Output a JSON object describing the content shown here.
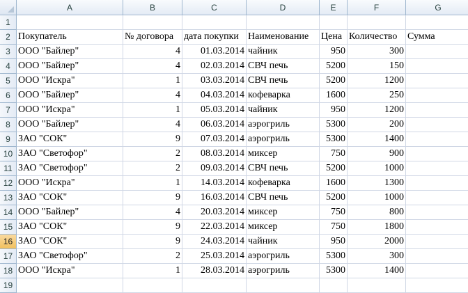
{
  "grid": {
    "columns": [
      "A",
      "B",
      "C",
      "D",
      "E",
      "F",
      "G"
    ],
    "active_row": "16",
    "rows": [
      {
        "n": "1",
        "cells": [
          "",
          "",
          "",
          "",
          "",
          "",
          ""
        ]
      },
      {
        "n": "2",
        "cells": [
          "Покупатель",
          "№ договора",
          "дата покупки",
          "Наименование",
          "Цена",
          "Количество",
          "Сумма"
        ]
      },
      {
        "n": "3",
        "cells": [
          "ООО \"Байлер\"",
          "4",
          "01.03.2014",
          "чайник",
          "950",
          "300",
          ""
        ]
      },
      {
        "n": "4",
        "cells": [
          "ООО \"Байлер\"",
          "4",
          "02.03.2014",
          "СВЧ печь",
          "5200",
          "150",
          ""
        ]
      },
      {
        "n": "5",
        "cells": [
          "ООО \"Искра\"",
          "1",
          "03.03.2014",
          "СВЧ печь",
          "5200",
          "1200",
          ""
        ]
      },
      {
        "n": "6",
        "cells": [
          "ООО \"Байлер\"",
          "4",
          "04.03.2014",
          "кофеварка",
          "1600",
          "250",
          ""
        ]
      },
      {
        "n": "7",
        "cells": [
          "ООО \"Искра\"",
          "1",
          "05.03.2014",
          "чайник",
          "950",
          "1200",
          ""
        ]
      },
      {
        "n": "8",
        "cells": [
          "ООО \"Байлер\"",
          "4",
          "06.03.2014",
          "аэрогриль",
          "5300",
          "200",
          ""
        ]
      },
      {
        "n": "9",
        "cells": [
          "ЗАО \"СОК\"",
          "9",
          "07.03.2014",
          "аэрогриль",
          "5300",
          "1400",
          ""
        ]
      },
      {
        "n": "10",
        "cells": [
          "ЗАО \"Светофор\"",
          "2",
          "08.03.2014",
          "миксер",
          "750",
          "900",
          ""
        ]
      },
      {
        "n": "11",
        "cells": [
          "ЗАО \"Светофор\"",
          "2",
          "09.03.2014",
          "СВЧ печь",
          "5200",
          "1000",
          ""
        ]
      },
      {
        "n": "12",
        "cells": [
          "ООО \"Искра\"",
          "1",
          "14.03.2014",
          "кофеварка",
          "1600",
          "1300",
          ""
        ]
      },
      {
        "n": "13",
        "cells": [
          "ЗАО \"СОК\"",
          "9",
          "16.03.2014",
          "СВЧ печь",
          "5200",
          "1000",
          ""
        ]
      },
      {
        "n": "14",
        "cells": [
          "ООО \"Байлер\"",
          "4",
          "20.03.2014",
          "миксер",
          "750",
          "800",
          ""
        ]
      },
      {
        "n": "15",
        "cells": [
          "ЗАО \"СОК\"",
          "9",
          "22.03.2014",
          "миксер",
          "750",
          "1800",
          ""
        ]
      },
      {
        "n": "16",
        "cells": [
          "ЗАО \"СОК\"",
          "9",
          "24.03.2014",
          "чайник",
          "950",
          "2000",
          ""
        ]
      },
      {
        "n": "17",
        "cells": [
          "ЗАО \"Светофор\"",
          "2",
          "25.03.2014",
          "аэрогриль",
          "5300",
          "300",
          ""
        ]
      },
      {
        "n": "18",
        "cells": [
          "ООО \"Искра\"",
          "1",
          "28.03.2014",
          "аэрогриль",
          "5300",
          "1400",
          ""
        ]
      },
      {
        "n": "19",
        "cells": [
          "",
          "",
          "",
          "",
          "",
          "",
          ""
        ]
      }
    ]
  }
}
